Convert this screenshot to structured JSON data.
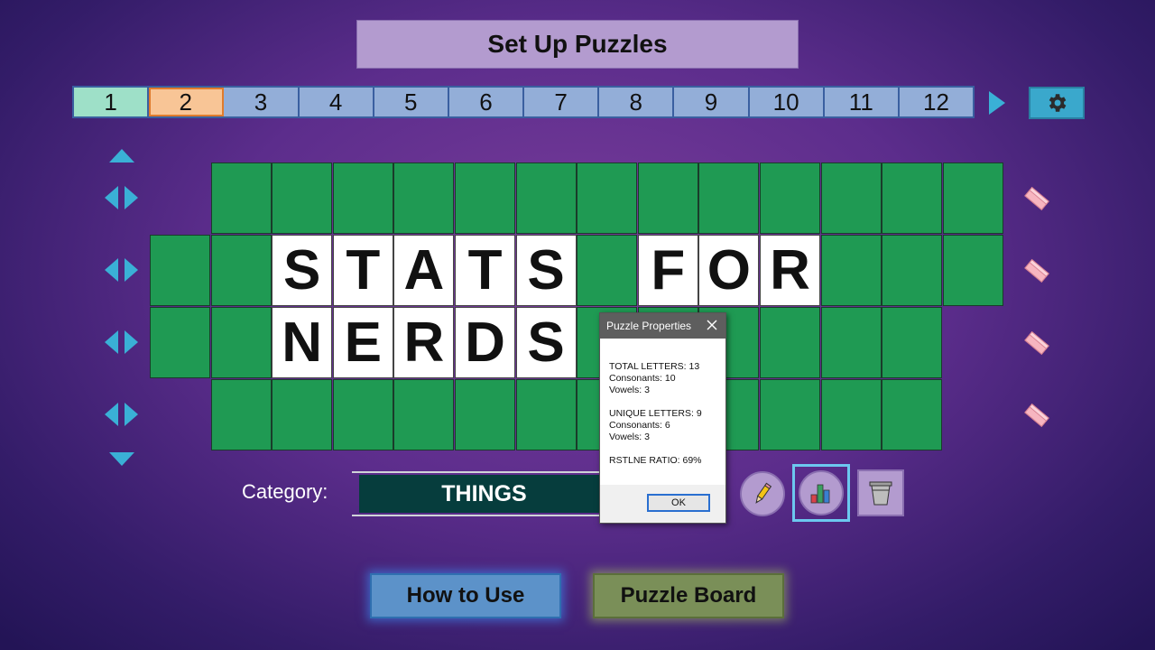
{
  "title": "Set Up Puzzles",
  "tabs": [
    "1",
    "2",
    "3",
    "4",
    "5",
    "6",
    "7",
    "8",
    "9",
    "10",
    "11",
    "12"
  ],
  "active_tab": "2",
  "rows": [
    {
      "cells": [
        "",
        "",
        "",
        "",
        "",
        "",
        "",
        "",
        "",
        "",
        "",
        "",
        ""
      ],
      "offset": 1
    },
    {
      "cells": [
        "",
        "",
        "S",
        "T",
        "A",
        "T",
        "S",
        "",
        "F",
        "O",
        "R",
        "",
        "",
        ""
      ],
      "offset": 0
    },
    {
      "cells": [
        "",
        "",
        "N",
        "E",
        "R",
        "D",
        "S",
        "",
        "",
        "",
        "",
        "",
        ""
      ],
      "offset": 0
    },
    {
      "cells": [
        "",
        "",
        "",
        "",
        "",
        "",
        "",
        "",
        "",
        "",
        "",
        ""
      ],
      "offset": 1
    }
  ],
  "category": {
    "label": "Category:",
    "value": "THINGS"
  },
  "dialog": {
    "title": "Puzzle Properties",
    "lines": [
      "TOTAL LETTERS: 13",
      "Consonants: 10",
      "Vowels: 3",
      "",
      "UNIQUE LETTERS: 9",
      "Consonants: 6",
      "Vowels: 3",
      "",
      "RSTLNE RATIO: 69%"
    ],
    "ok_label": "OK"
  },
  "buttons": {
    "how_to_use": "How to Use",
    "puzzle_board": "Puzzle Board"
  },
  "icons": {
    "settings": "gear-icon",
    "edit": "pencil-icon",
    "stats": "bar-chart-icon",
    "delete": "trash-icon",
    "clear_row": "eraser-icon"
  },
  "colors": {
    "board_green": "#1f9a53",
    "tab_active": "#f8c596",
    "tab_done": "#9ee0c8",
    "tab_default": "#93aed8",
    "accent_cyan": "#3ab0d6"
  }
}
